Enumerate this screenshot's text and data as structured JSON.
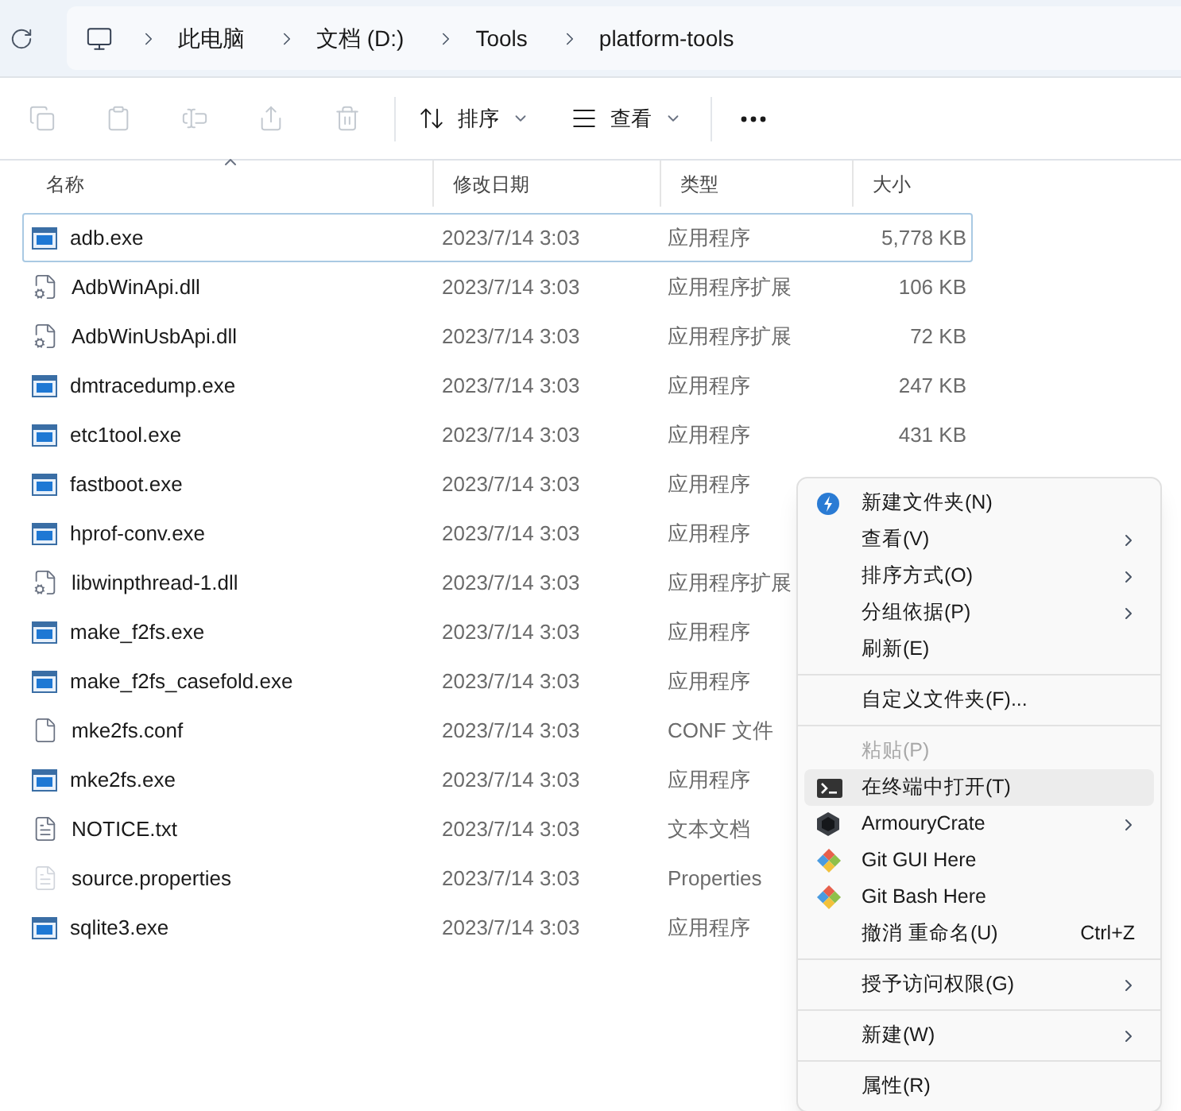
{
  "breadcrumb": [
    "此电脑",
    "文档 (D:)",
    "Tools",
    "platform-tools"
  ],
  "toolbar": {
    "icon_buttons": [
      {
        "kind": "copy",
        "disabled": true
      },
      {
        "kind": "paste",
        "disabled": true
      },
      {
        "kind": "rename",
        "disabled": true
      },
      {
        "kind": "share",
        "disabled": true
      },
      {
        "kind": "delete",
        "disabled": true
      }
    ],
    "menus": [
      {
        "kind": "sort",
        "label": "排序"
      },
      {
        "kind": "view",
        "label": "查看"
      }
    ]
  },
  "columns": [
    {
      "label": "名称",
      "sorted": true
    },
    {
      "label": "修改日期",
      "sorted": false
    },
    {
      "label": "类型",
      "sorted": false
    },
    {
      "label": "大小",
      "sorted": false
    }
  ],
  "rows": [
    {
      "kind": "exe",
      "name": "adb.exe",
      "date": "2023/7/14 3:03",
      "type": "应用程序",
      "size": "5,778 KB",
      "focused": true
    },
    {
      "kind": "dll",
      "name": "AdbWinApi.dll",
      "date": "2023/7/14 3:03",
      "type": "应用程序扩展",
      "size": "106 KB",
      "focused": false
    },
    {
      "kind": "dll",
      "name": "AdbWinUsbApi.dll",
      "date": "2023/7/14 3:03",
      "type": "应用程序扩展",
      "size": "72 KB",
      "focused": false
    },
    {
      "kind": "exe",
      "name": "dmtracedump.exe",
      "date": "2023/7/14 3:03",
      "type": "应用程序",
      "size": "247 KB",
      "focused": false
    },
    {
      "kind": "exe",
      "name": "etc1tool.exe",
      "date": "2023/7/14 3:03",
      "type": "应用程序",
      "size": "431 KB",
      "focused": false
    },
    {
      "kind": "exe",
      "name": "fastboot.exe",
      "date": "2023/7/14 3:03",
      "type": "应用程序",
      "focused": false
    },
    {
      "kind": "exe",
      "name": "hprof-conv.exe",
      "date": "2023/7/14 3:03",
      "type": "应用程序",
      "focused": false
    },
    {
      "kind": "dll",
      "name": "libwinpthread-1.dll",
      "date": "2023/7/14 3:03",
      "type": "应用程序扩展",
      "focused": false
    },
    {
      "kind": "exe",
      "name": "make_f2fs.exe",
      "date": "2023/7/14 3:03",
      "type": "应用程序",
      "focused": false
    },
    {
      "kind": "exe",
      "name": "make_f2fs_casefold.exe",
      "date": "2023/7/14 3:03",
      "type": "应用程序",
      "focused": false
    },
    {
      "kind": "conf",
      "name": "mke2fs.conf",
      "date": "2023/7/14 3:03",
      "type": "CONF 文件",
      "focused": false
    },
    {
      "kind": "exe",
      "name": "mke2fs.exe",
      "date": "2023/7/14 3:03",
      "type": "应用程序",
      "focused": false
    },
    {
      "kind": "txt",
      "name": "NOTICE.txt",
      "date": "2023/7/14 3:03",
      "type": "文本文档",
      "focused": false
    },
    {
      "kind": "properties",
      "name": "source.properties",
      "date": "2023/7/14 3:03",
      "type": "Properties",
      "focused": false
    },
    {
      "kind": "exe",
      "name": "sqlite3.exe",
      "date": "2023/7/14 3:03",
      "type": "应用程序",
      "focused": false
    }
  ],
  "context_menu": [
    {
      "kind": "app",
      "label": "新建文件夹(N)",
      "submenu": false,
      "disabled": false,
      "selected": false
    },
    {
      "kind": "plain",
      "label": "查看(V)",
      "submenu": true,
      "disabled": false,
      "selected": false
    },
    {
      "kind": "plain",
      "label": "排序方式(O)",
      "submenu": true,
      "disabled": false,
      "selected": false
    },
    {
      "kind": "plain",
      "label": "分组依据(P)",
      "submenu": true,
      "disabled": false,
      "selected": false
    },
    {
      "kind": "plain",
      "label": "刷新(E)",
      "submenu": false,
      "disabled": false,
      "selected": false
    },
    {
      "kind": "separator"
    },
    {
      "kind": "plain",
      "label": "自定义文件夹(F)...",
      "submenu": false,
      "disabled": false,
      "selected": false
    },
    {
      "kind": "separator"
    },
    {
      "kind": "plain",
      "label": "粘贴(P)",
      "submenu": false,
      "disabled": true,
      "selected": false
    },
    {
      "kind": "terminal",
      "label": "在终端中打开(T)",
      "submenu": false,
      "disabled": false,
      "selected": true
    },
    {
      "kind": "armoury",
      "label": "ArmouryCrate",
      "submenu": true,
      "disabled": false,
      "selected": false
    },
    {
      "kind": "git",
      "label": "Git GUI Here",
      "submenu": false,
      "disabled": false,
      "selected": false
    },
    {
      "kind": "git",
      "label": "Git Bash Here",
      "submenu": false,
      "disabled": false,
      "selected": false
    },
    {
      "kind": "plain",
      "label": "撤消 重命名(U)",
      "shortcut": "Ctrl+Z",
      "submenu": false,
      "disabled": false,
      "selected": false
    },
    {
      "kind": "separator"
    },
    {
      "kind": "plain",
      "label": "授予访问权限(G)",
      "submenu": true,
      "disabled": false,
      "selected": false
    },
    {
      "kind": "separator"
    },
    {
      "kind": "plain",
      "label": "新建(W)",
      "submenu": true,
      "disabled": false,
      "selected": false
    },
    {
      "kind": "separator"
    },
    {
      "kind": "plain",
      "label": "属性(R)",
      "submenu": false,
      "disabled": false,
      "selected": false
    }
  ]
}
